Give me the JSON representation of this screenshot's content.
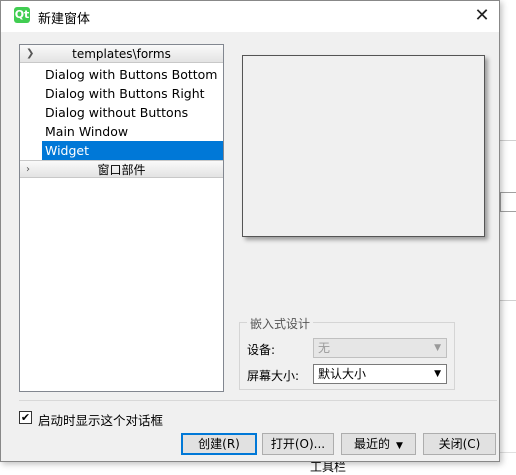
{
  "window": {
    "title": "新建窗体",
    "icon": "qt-creator-icon"
  },
  "tree": {
    "groups": [
      {
        "label": "templates\\forms",
        "expanded": true
      },
      {
        "label": "窗口部件",
        "expanded": false
      }
    ],
    "items": [
      {
        "label": "Dialog with Buttons Bottom"
      },
      {
        "label": "Dialog with Buttons Right"
      },
      {
        "label": "Dialog without Buttons"
      },
      {
        "label": "Main Window"
      },
      {
        "label": "Widget",
        "selected": true
      }
    ]
  },
  "embedded": {
    "title": "嵌入式设计",
    "device_label": "设备:",
    "device_value": "无",
    "screen_label": "屏幕大小:",
    "screen_value": "默认大小"
  },
  "show_on_startup": {
    "label": "启动时显示这个对话框",
    "checked": true
  },
  "buttons": {
    "create": "创建(R)",
    "open": "打开(O)...",
    "recent": "最近的",
    "close": "关闭(C)"
  },
  "background": {
    "bottom_text": "工具栏"
  },
  "colors": {
    "selection": "#0078d7",
    "accent": "#41cd52"
  }
}
